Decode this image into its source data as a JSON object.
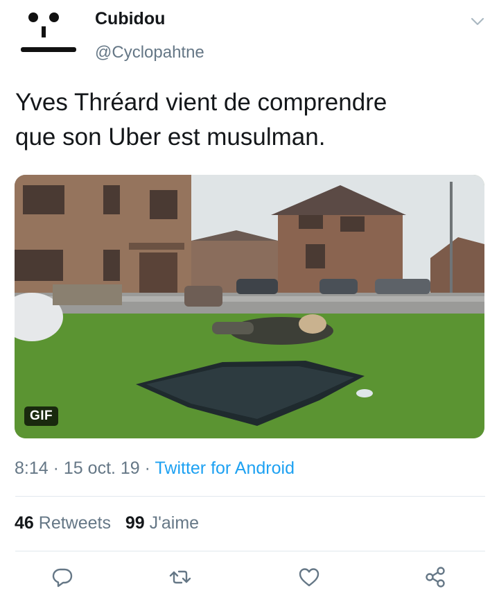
{
  "author": {
    "name": "Cubidou",
    "handle": "@Cyclopahtne"
  },
  "tweet": {
    "text_line1": "Yves Thréard vient de comprendre",
    "text_line2": "que son Uber est musulman."
  },
  "media": {
    "badge": "GIF"
  },
  "meta": {
    "time": "8:14",
    "separator": "·",
    "date": "15 oct. 19",
    "source": "Twitter for Android"
  },
  "stats": {
    "retweets_count": "46",
    "retweets_label": "Retweets",
    "likes_count": "99",
    "likes_label": "J'aime"
  },
  "icons": {
    "more": "chevron-down-icon",
    "reply": "reply-icon",
    "retweet": "retweet-icon",
    "like": "heart-icon",
    "share": "share-icon"
  },
  "colors": {
    "accent": "#1da1f2",
    "secondary_text": "#657786",
    "icon": "#657786"
  }
}
